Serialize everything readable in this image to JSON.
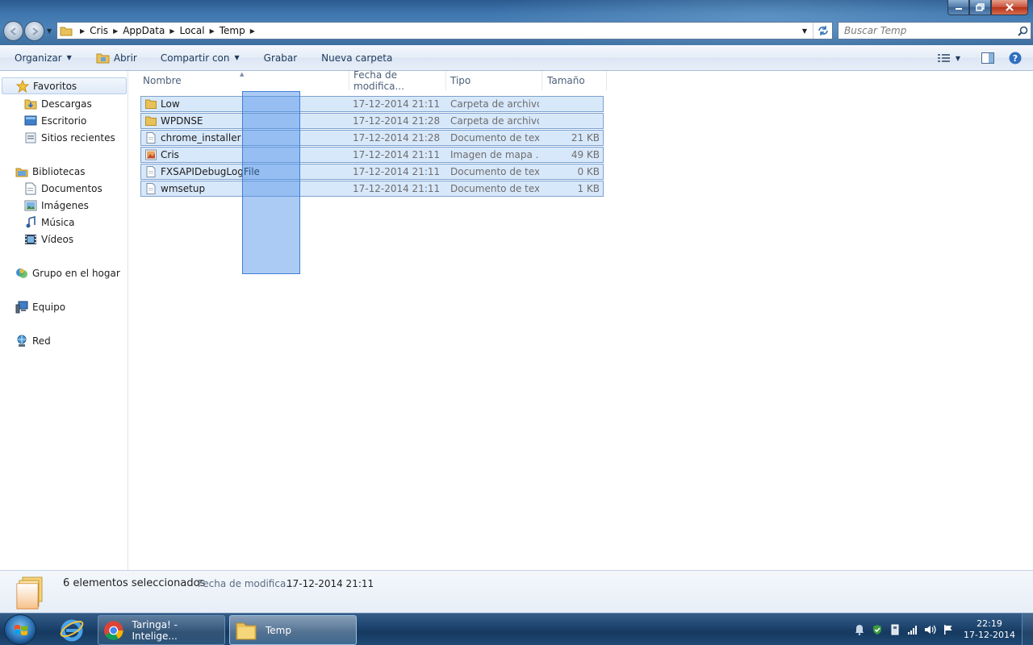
{
  "window": {
    "breadcrumbs": [
      "Cris",
      "AppData",
      "Local",
      "Temp"
    ],
    "search_placeholder": "Buscar Temp"
  },
  "toolbar": {
    "organize": "Organizar",
    "open": "Abrir",
    "share": "Compartir con",
    "burn": "Grabar",
    "new_folder": "Nueva carpeta"
  },
  "sidebar": {
    "favorites": "Favoritos",
    "downloads": "Descargas",
    "desktop": "Escritorio",
    "recent": "Sitios recientes",
    "libraries": "Bibliotecas",
    "documents": "Documentos",
    "pictures": "Imágenes",
    "music": "Música",
    "videos": "Vídeos",
    "homegroup": "Grupo en el hogar",
    "computer": "Equipo",
    "network": "Red"
  },
  "columns": {
    "name": "Nombre",
    "date": "Fecha de modifica...",
    "type": "Tipo",
    "size": "Tamaño"
  },
  "files": [
    {
      "name": "Low",
      "date": "17-12-2014 21:11",
      "type": "Carpeta de archivos",
      "size": "",
      "icon": "folder-icon"
    },
    {
      "name": "WPDNSE",
      "date": "17-12-2014 21:28",
      "type": "Carpeta de archivos",
      "size": "",
      "icon": "folder-icon"
    },
    {
      "name": "chrome_installer",
      "date": "17-12-2014 21:28",
      "type": "Documento de tex...",
      "size": "21 KB",
      "icon": "text-file-icon"
    },
    {
      "name": "Cris",
      "date": "17-12-2014 21:11",
      "type": "Imagen de mapa ...",
      "size": "49 KB",
      "icon": "bitmap-file-icon"
    },
    {
      "name": "FXSAPIDebugLogFile",
      "date": "17-12-2014 21:11",
      "type": "Documento de tex...",
      "size": "0 KB",
      "icon": "text-file-icon"
    },
    {
      "name": "wmsetup",
      "date": "17-12-2014 21:11",
      "type": "Documento de tex...",
      "size": "1 KB",
      "icon": "text-file-icon"
    }
  ],
  "details": {
    "selected": "6 elementos seleccionados",
    "meta_label": "Fecha de modifica...",
    "meta_value": "17-12-2014 21:11"
  },
  "taskbar": {
    "chrome_label": "Taringa! - Intelige...",
    "explorer_label": "Temp",
    "time": "22:19",
    "date": "17-12-2014"
  }
}
